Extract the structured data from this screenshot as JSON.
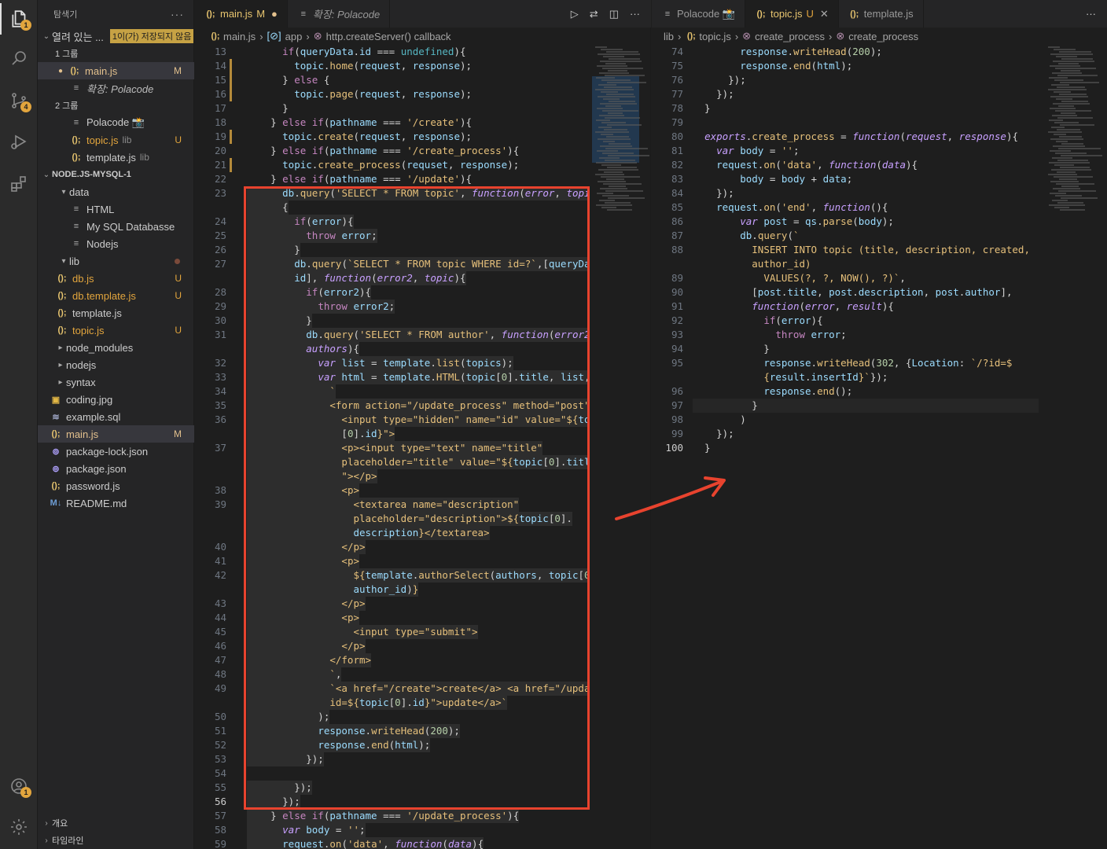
{
  "activity": {
    "explorer_badge": "1",
    "scm_badge": "4",
    "account_badge": "1"
  },
  "explorer": {
    "title": "탐색기",
    "open_editors": "열려 있는 ...",
    "unsaved_tag": "1이(가) 저장되지 않음",
    "group1": "1 그룹",
    "group2": "2 그룹",
    "g1_main": "main.js",
    "g1_main_st": "M",
    "g1_ext": "확장: Polacode",
    "g2_pola": "Polacode 📸",
    "g2_topic": "topic.js",
    "g2_topic_dsc": "lib",
    "g2_topic_st": "U",
    "g2_tpl": "template.js",
    "g2_tpl_dsc": "lib",
    "project": "NODE.JS-MYSQL-1",
    "items": [
      {
        "label": "data",
        "kind": "folder-open"
      },
      {
        "label": "HTML",
        "kind": "txt"
      },
      {
        "label": "My SQL Databasse",
        "kind": "txt"
      },
      {
        "label": "Nodejs",
        "kind": "txt"
      },
      {
        "label": "lib",
        "kind": "folder-open"
      },
      {
        "label": "db.js",
        "kind": "js",
        "st": "U"
      },
      {
        "label": "db.template.js",
        "kind": "js",
        "st": "U"
      },
      {
        "label": "template.js",
        "kind": "js"
      },
      {
        "label": "topic.js",
        "kind": "js",
        "st": "U"
      },
      {
        "label": "node_modules",
        "kind": "folder"
      },
      {
        "label": "nodejs",
        "kind": "folder"
      },
      {
        "label": "syntax",
        "kind": "folder"
      },
      {
        "label": "coding.jpg",
        "kind": "img"
      },
      {
        "label": "example.sql",
        "kind": "sql"
      },
      {
        "label": "main.js",
        "kind": "js",
        "st": "M"
      },
      {
        "label": "package-lock.json",
        "kind": "json"
      },
      {
        "label": "package.json",
        "kind": "json"
      },
      {
        "label": "password.js",
        "kind": "js"
      },
      {
        "label": "README.md",
        "kind": "md"
      }
    ],
    "outline": "개요",
    "timeline": "타임라인"
  },
  "left_editor": {
    "tabs": [
      {
        "label": "main.js",
        "status": "M"
      },
      {
        "label": "확장: Polacode"
      }
    ],
    "crumbs": [
      "main.js",
      "app",
      "http.createServer() callback"
    ]
  },
  "right_editor": {
    "tabs": [
      {
        "label": "Polacode 📸"
      },
      {
        "label": "topic.js",
        "status": "U"
      },
      {
        "label": "template.js"
      }
    ],
    "crumbs": [
      "lib",
      "topic.js",
      "create_process",
      "create_process"
    ]
  }
}
